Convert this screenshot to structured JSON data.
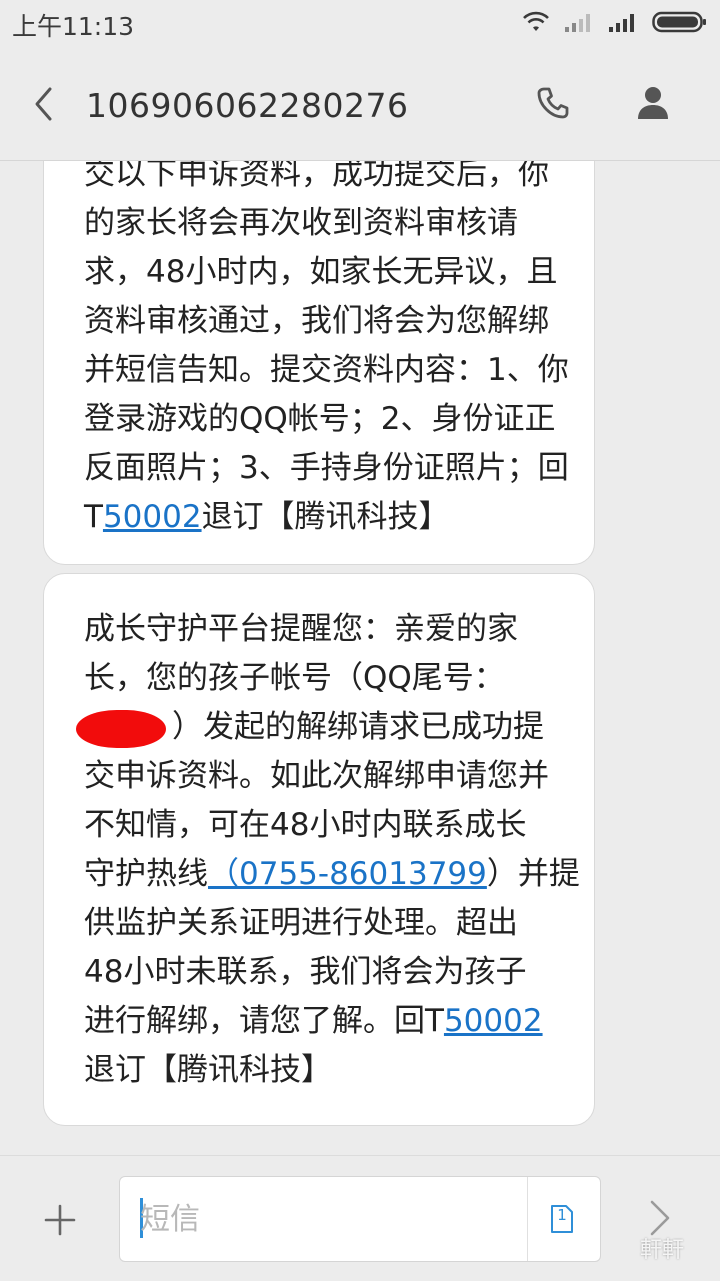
{
  "status_bar": {
    "time": "上午11:13",
    "icons": [
      "wifi-icon",
      "signal-icon-1",
      "signal-icon-2",
      "battery-icon"
    ]
  },
  "header": {
    "back_icon": "chevron-left-icon",
    "title": "106906062280276",
    "call_icon": "phone-icon",
    "contact_icon": "person-icon"
  },
  "messages": [
    {
      "lines": [
        "交以下申诉资料，成功提交后，你",
        "的家长将会再次收到资料审核请",
        "求，48小时内，如家长无异议，且",
        "资料审核通过，我们将会为您解绑",
        "并短信告知。提交资料内容：1、你",
        "登录游戏的QQ帐号；2、身份证正",
        "反面照片；3、手持身份证照片；回"
      ],
      "last_line": {
        "prefix": "T",
        "link": "50002",
        "suffix": "退订【腾讯科技】"
      }
    },
    {
      "line_1": "成长守护平台提醒您：亲爱的家",
      "line_2": "长，您的孩子帐号（QQ尾号：",
      "line_3": "）发起的解绑请求已成功提",
      "line_4": "交申诉资料。如此次解绑申请您并",
      "line_5": "不知情，可在48小时内联系成长",
      "line_6": {
        "prefix": "守护热线",
        "link": "（0755-86013799",
        "suffix": "）并提"
      },
      "line_7": "供监护关系证明进行处理。超出",
      "line_8": "48小时未联系，我们将会为孩子",
      "line_9": {
        "prefix": "进行解绑，请您了解。回T",
        "link": "50002"
      },
      "line_10": "退订【腾讯科技】"
    }
  ],
  "compose": {
    "add_icon": "plus-icon",
    "placeholder": "短信",
    "sim_label": "1",
    "send_icon": "chevron-right-icon"
  },
  "watermark": "軒軒",
  "colors": {
    "background": "#ececec",
    "bubble": "#ffffff",
    "link": "#1a73c7",
    "redaction": "#f20c0c",
    "caret": "#2f8fd8"
  }
}
